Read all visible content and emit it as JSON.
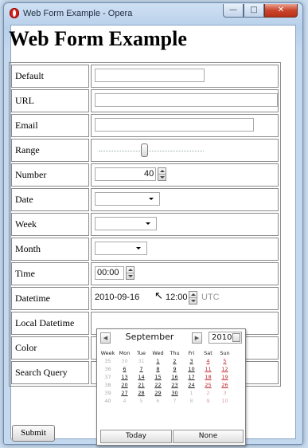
{
  "window": {
    "title": "Web Form Example - Opera",
    "minimize_icon": "minimize-icon",
    "maximize_icon": "maximize-icon",
    "close_icon": "close-icon"
  },
  "page": {
    "heading": "Web Form Example"
  },
  "form": {
    "rows": [
      {
        "label": "Default"
      },
      {
        "label": "URL"
      },
      {
        "label": "Email"
      },
      {
        "label": "Range"
      },
      {
        "label": "Number",
        "value": "40"
      },
      {
        "label": "Date"
      },
      {
        "label": "Week"
      },
      {
        "label": "Month"
      },
      {
        "label": "Time",
        "value": "00:00"
      },
      {
        "label": "Datetime",
        "date": "2010-09-16",
        "time": "12:00",
        "zone": "UTC"
      },
      {
        "label": "Local Datetime"
      },
      {
        "label": "Color"
      },
      {
        "label": "Search Query"
      }
    ],
    "range_value": 0.43,
    "submit_label": "Submit"
  },
  "calendar": {
    "month": "September",
    "year": "2010",
    "prev_icon": "chevron-left-icon",
    "next_icon": "chevron-right-icon",
    "headers": [
      "Week",
      "Mon",
      "Tue",
      "Wed",
      "Thu",
      "Fri",
      "Sat",
      "Sun"
    ],
    "weeks": [
      [
        "35",
        "30",
        "31",
        "1",
        "2",
        "3",
        "4",
        "5"
      ],
      [
        "36",
        "6",
        "7",
        "8",
        "9",
        "10",
        "11",
        "12"
      ],
      [
        "37",
        "13",
        "14",
        "15",
        "16",
        "17",
        "18",
        "19"
      ],
      [
        "38",
        "20",
        "21",
        "22",
        "23",
        "24",
        "25",
        "26"
      ],
      [
        "39",
        "27",
        "28",
        "29",
        "30",
        "1",
        "2",
        "3"
      ],
      [
        "40",
        "4",
        "5",
        "6",
        "7",
        "8",
        "9",
        "10"
      ]
    ],
    "today_label": "Today",
    "none_label": "None"
  }
}
